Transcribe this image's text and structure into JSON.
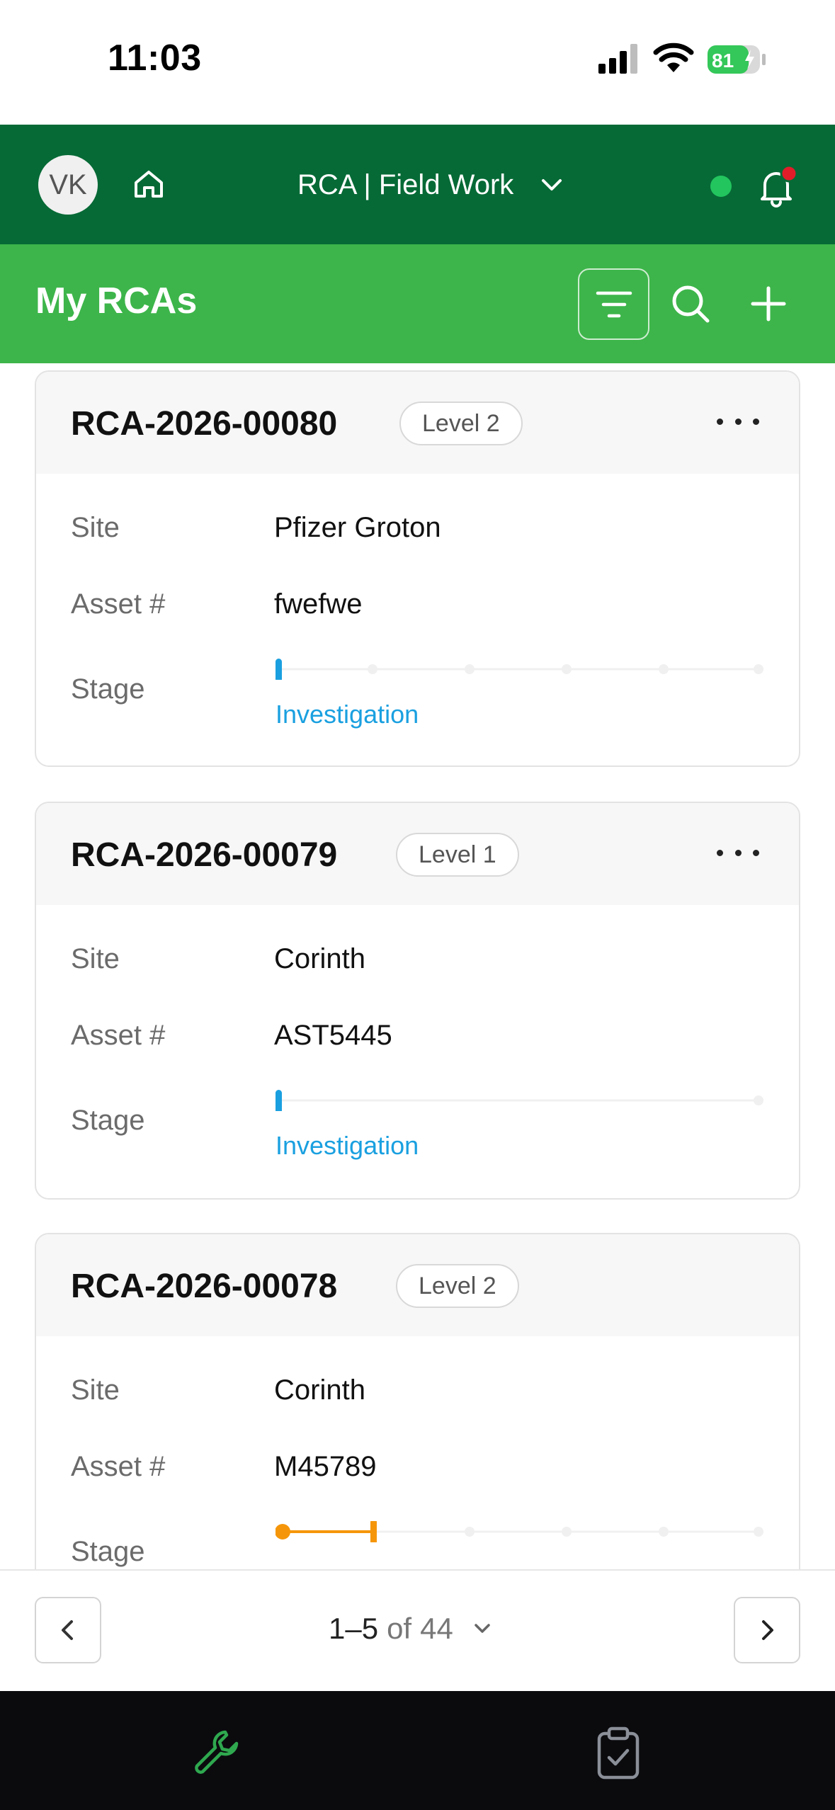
{
  "status_bar": {
    "time": "11:03",
    "battery": "81"
  },
  "top_bar": {
    "avatar_initials": "VK",
    "app_name": "RCA | Field Work"
  },
  "page_header": {
    "title": "My RCAs"
  },
  "cards": [
    {
      "id": "RCA-2026-00080",
      "level": "Level 2",
      "site_label": "Site",
      "site": "Pfizer Groton",
      "asset_label": "Asset #",
      "asset": "fwefwe",
      "stage_label": "Stage",
      "stage": "Investigation"
    },
    {
      "id": "RCA-2026-00079",
      "level": "Level 1",
      "site_label": "Site",
      "site": "Corinth",
      "asset_label": "Asset #",
      "asset": "AST5445",
      "stage_label": "Stage",
      "stage": "Investigation"
    },
    {
      "id": "RCA-2026-00078",
      "level": "Level 2",
      "site_label": "Site",
      "site": "Corinth",
      "asset_label": "Asset #",
      "asset": "M45789",
      "stage_label": "Stage",
      "stage": ""
    }
  ],
  "pagination": {
    "range": "1–5",
    "of": "of",
    "total": "44"
  },
  "colors": {
    "top_bar": "#066a36",
    "page_header": "#3db54a",
    "stage_blue": "#1aa0e0",
    "stage_orange": "#f5960a",
    "online": "#22c55e",
    "notification": "#e11d2a"
  },
  "icons": {
    "home": "home-icon",
    "bell": "bell-icon",
    "filter": "filter-icon",
    "search": "search-icon",
    "add": "plus-icon",
    "wrench": "wrench-icon",
    "checklist": "clipboard-check-icon"
  }
}
